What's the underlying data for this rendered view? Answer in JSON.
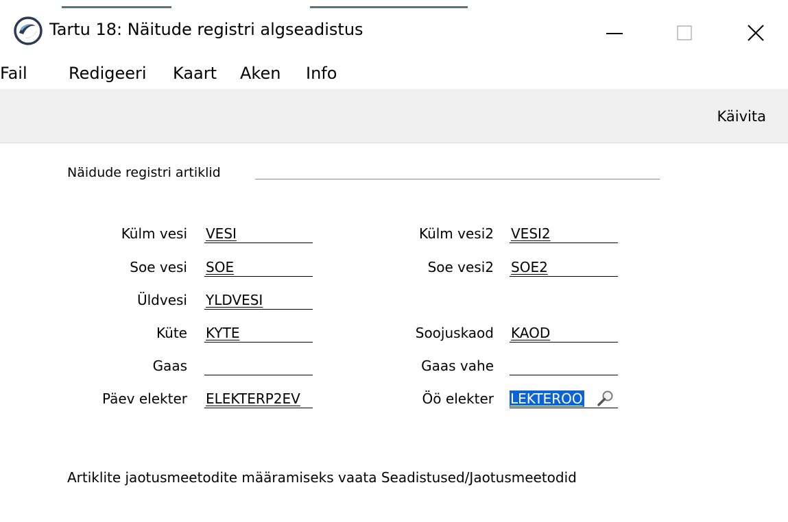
{
  "window": {
    "title": "Tartu 18: Näitude registri algseadistus",
    "accent_color": "#0a64d2"
  },
  "menubar": {
    "items": [
      {
        "label": "Fail"
      },
      {
        "label": "Redigeeri"
      },
      {
        "label": "Kaart"
      },
      {
        "label": "Aken"
      },
      {
        "label": "Info"
      }
    ]
  },
  "toolbar": {
    "run_label": "Käivita"
  },
  "section": {
    "header": "Näidude registri artiklid"
  },
  "fields": {
    "kylm_vesi": {
      "label": "Külm vesi",
      "value": "VESI"
    },
    "soe_vesi": {
      "label": "Soe vesi",
      "value": "SOE"
    },
    "yldvesi": {
      "label": "Üldvesi",
      "value": "YLDVESI"
    },
    "kyte": {
      "label": "Küte",
      "value": "KYTE"
    },
    "gaas": {
      "label": "Gaas",
      "value": ""
    },
    "paev_elekter": {
      "label": "Päev elekter",
      "value": "ELEKTERP2EV"
    },
    "kylm_vesi2": {
      "label": "Külm vesi2",
      "value": "VESI2"
    },
    "soe_vesi2": {
      "label": "Soe vesi2",
      "value": "SOE2"
    },
    "soojuskaod": {
      "label": "Soojuskaod",
      "value": "KAOD"
    },
    "gaas_vahe": {
      "label": "Gaas vahe",
      "value": ""
    },
    "oo_elekter": {
      "label": "Öö elekter",
      "value": "LEKTEROO"
    }
  },
  "footer": {
    "note": "Artiklite jaotusmeetodite määramiseks vaata Seadistused/Jaotusmeetodid"
  },
  "icons": {
    "app": "app-logo-icon",
    "minimize": "minimize-icon",
    "maximize": "maximize-icon",
    "close": "close-icon",
    "lookup": "magnifier-icon"
  }
}
